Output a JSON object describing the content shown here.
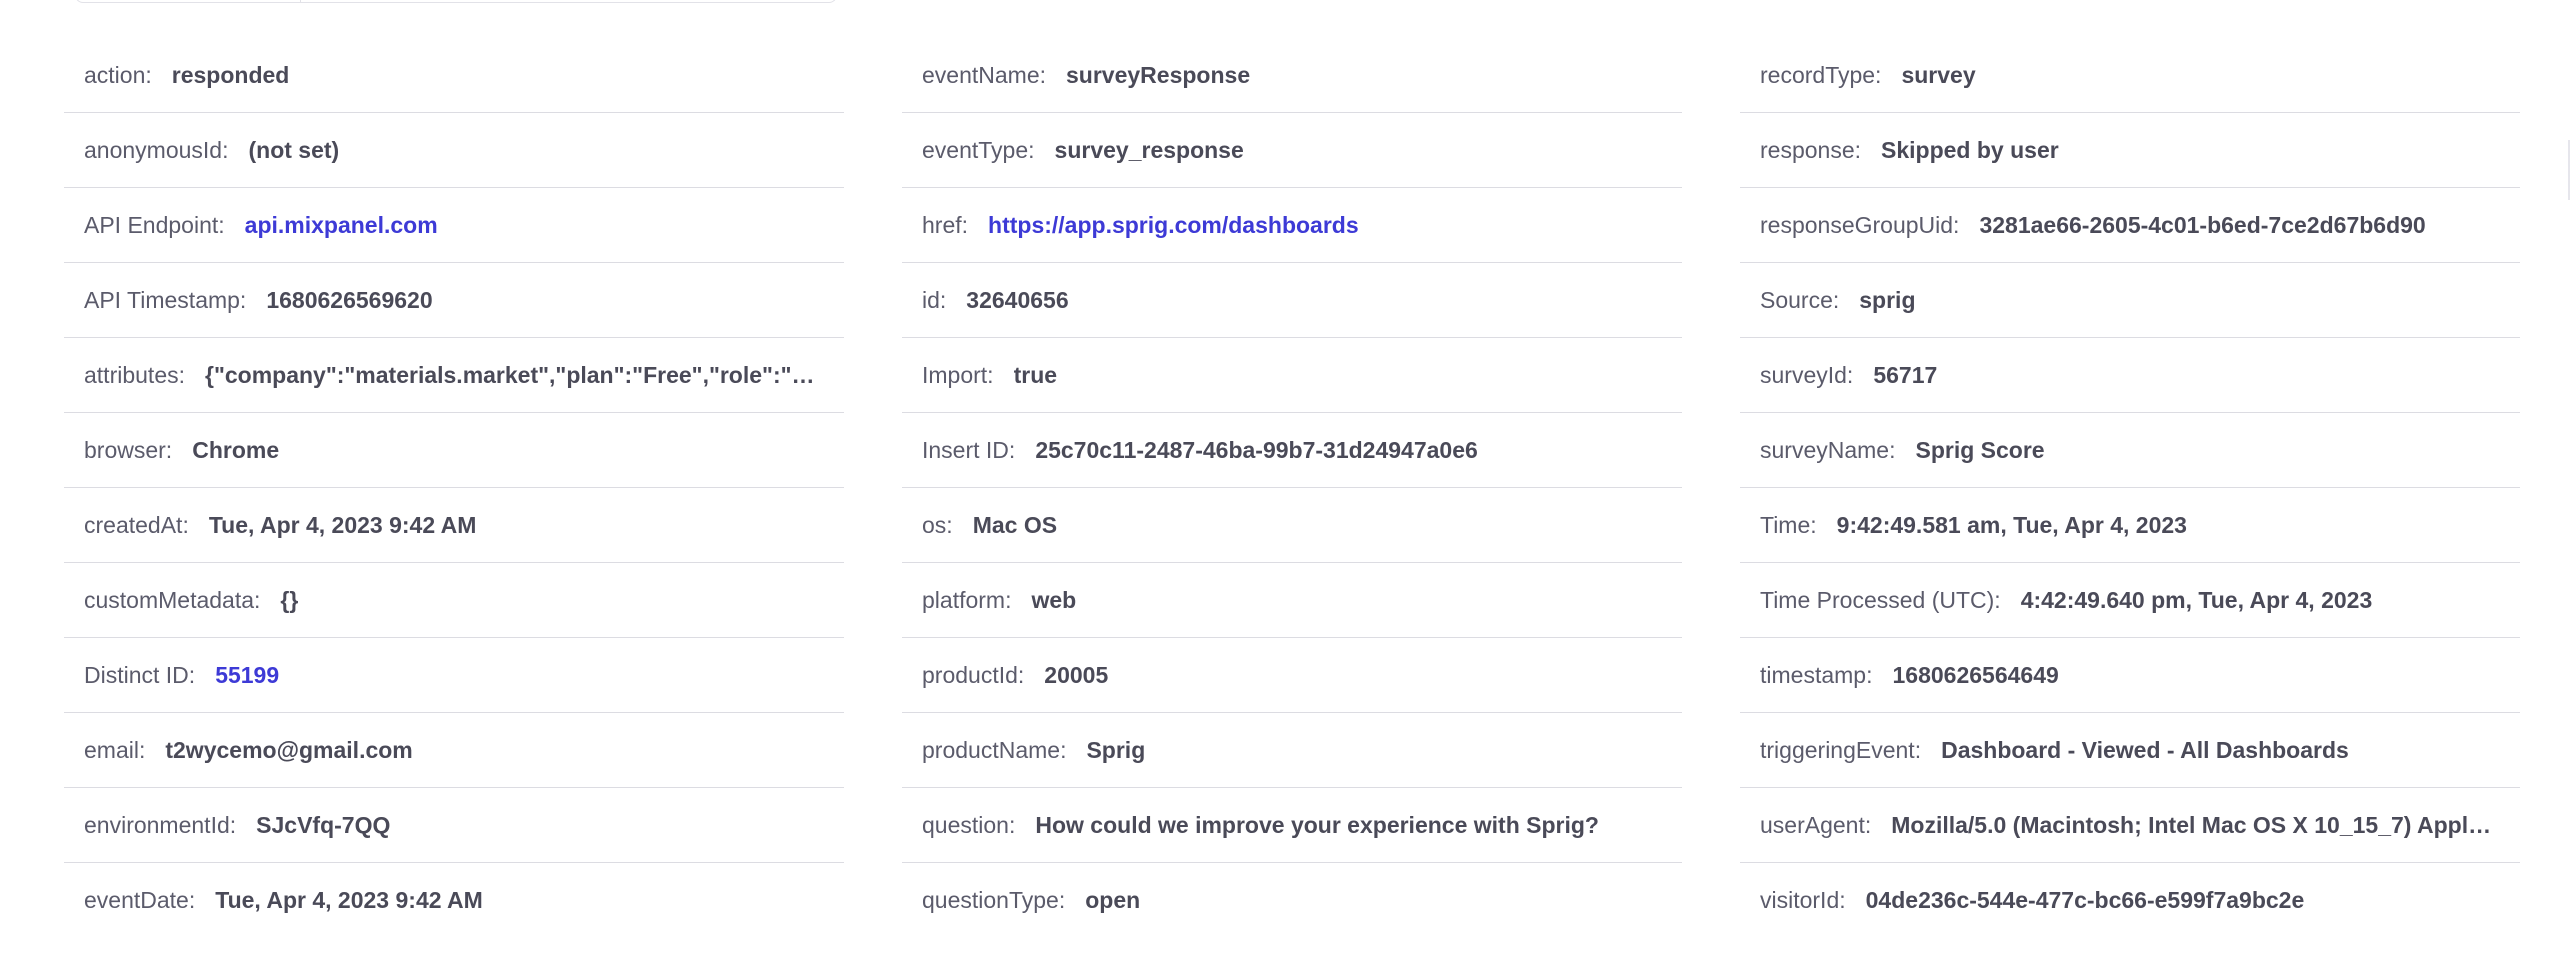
{
  "properties": {
    "col1": [
      {
        "key": "action:",
        "value": "responded",
        "link": false
      },
      {
        "key": "anonymousId:",
        "value": "(not set)",
        "link": false
      },
      {
        "key": "API Endpoint:",
        "value": "api.mixpanel.com",
        "link": true
      },
      {
        "key": "API Timestamp:",
        "value": "1680626569620",
        "link": false
      },
      {
        "key": "attributes:",
        "value": "{\"company\":\"materials.market\",\"plan\":\"Free\",\"role\":\"ad...",
        "link": false
      },
      {
        "key": "browser:",
        "value": "Chrome",
        "link": false
      },
      {
        "key": "createdAt:",
        "value": "Tue, Apr 4, 2023 9:42 AM",
        "link": false
      },
      {
        "key": "customMetadata:",
        "value": "{}",
        "link": false
      },
      {
        "key": "Distinct ID:",
        "value": "55199",
        "link": true
      },
      {
        "key": "email:",
        "value": "t2wycemo@gmail.com",
        "link": false
      },
      {
        "key": "environmentId:",
        "value": "SJcVfq-7QQ",
        "link": false
      },
      {
        "key": "eventDate:",
        "value": "Tue, Apr 4, 2023 9:42 AM",
        "link": false
      }
    ],
    "col2": [
      {
        "key": "eventName:",
        "value": "surveyResponse",
        "link": false
      },
      {
        "key": "eventType:",
        "value": "survey_response",
        "link": false
      },
      {
        "key": "href:",
        "value": "https://app.sprig.com/dashboards",
        "link": true
      },
      {
        "key": "id:",
        "value": "32640656",
        "link": false
      },
      {
        "key": "Import:",
        "value": "true",
        "link": false
      },
      {
        "key": "Insert ID:",
        "value": "25c70c11-2487-46ba-99b7-31d24947a0e6",
        "link": false
      },
      {
        "key": "os:",
        "value": "Mac OS",
        "link": false
      },
      {
        "key": "platform:",
        "value": "web",
        "link": false
      },
      {
        "key": "productId:",
        "value": "20005",
        "link": false
      },
      {
        "key": "productName:",
        "value": "Sprig",
        "link": false
      },
      {
        "key": "question:",
        "value": "How could we improve your experience with Sprig?",
        "link": false
      },
      {
        "key": "questionType:",
        "value": "open",
        "link": false
      }
    ],
    "col3": [
      {
        "key": "recordType:",
        "value": "survey",
        "link": false
      },
      {
        "key": "response:",
        "value": "Skipped by user",
        "link": false
      },
      {
        "key": "responseGroupUid:",
        "value": "3281ae66-2605-4c01-b6ed-7ce2d67b6d90",
        "link": false
      },
      {
        "key": "Source:",
        "value": "sprig",
        "link": false
      },
      {
        "key": "surveyId:",
        "value": "56717",
        "link": false
      },
      {
        "key": "surveyName:",
        "value": "Sprig Score",
        "link": false
      },
      {
        "key": "Time:",
        "value": "9:42:49.581 am, Tue, Apr 4, 2023",
        "link": false
      },
      {
        "key": "Time Processed (UTC):",
        "value": "4:42:49.640 pm, Tue, Apr 4, 2023",
        "link": false
      },
      {
        "key": "timestamp:",
        "value": "1680626564649",
        "link": false
      },
      {
        "key": "triggeringEvent:",
        "value": "Dashboard - Viewed - All Dashboards",
        "link": false
      },
      {
        "key": "userAgent:",
        "value": "Mozilla/5.0 (Macintosh; Intel Mac OS X 10_15_7) Apple...",
        "link": false
      },
      {
        "key": "visitorId:",
        "value": "04de236c-544e-477c-bc66-e599f7a9bc2e",
        "link": false
      }
    ]
  },
  "colors": {
    "link": "#3d3ad6",
    "key_text": "#5b5b6b",
    "value_text": "#4a4a58",
    "divider": "#dcdce2"
  }
}
